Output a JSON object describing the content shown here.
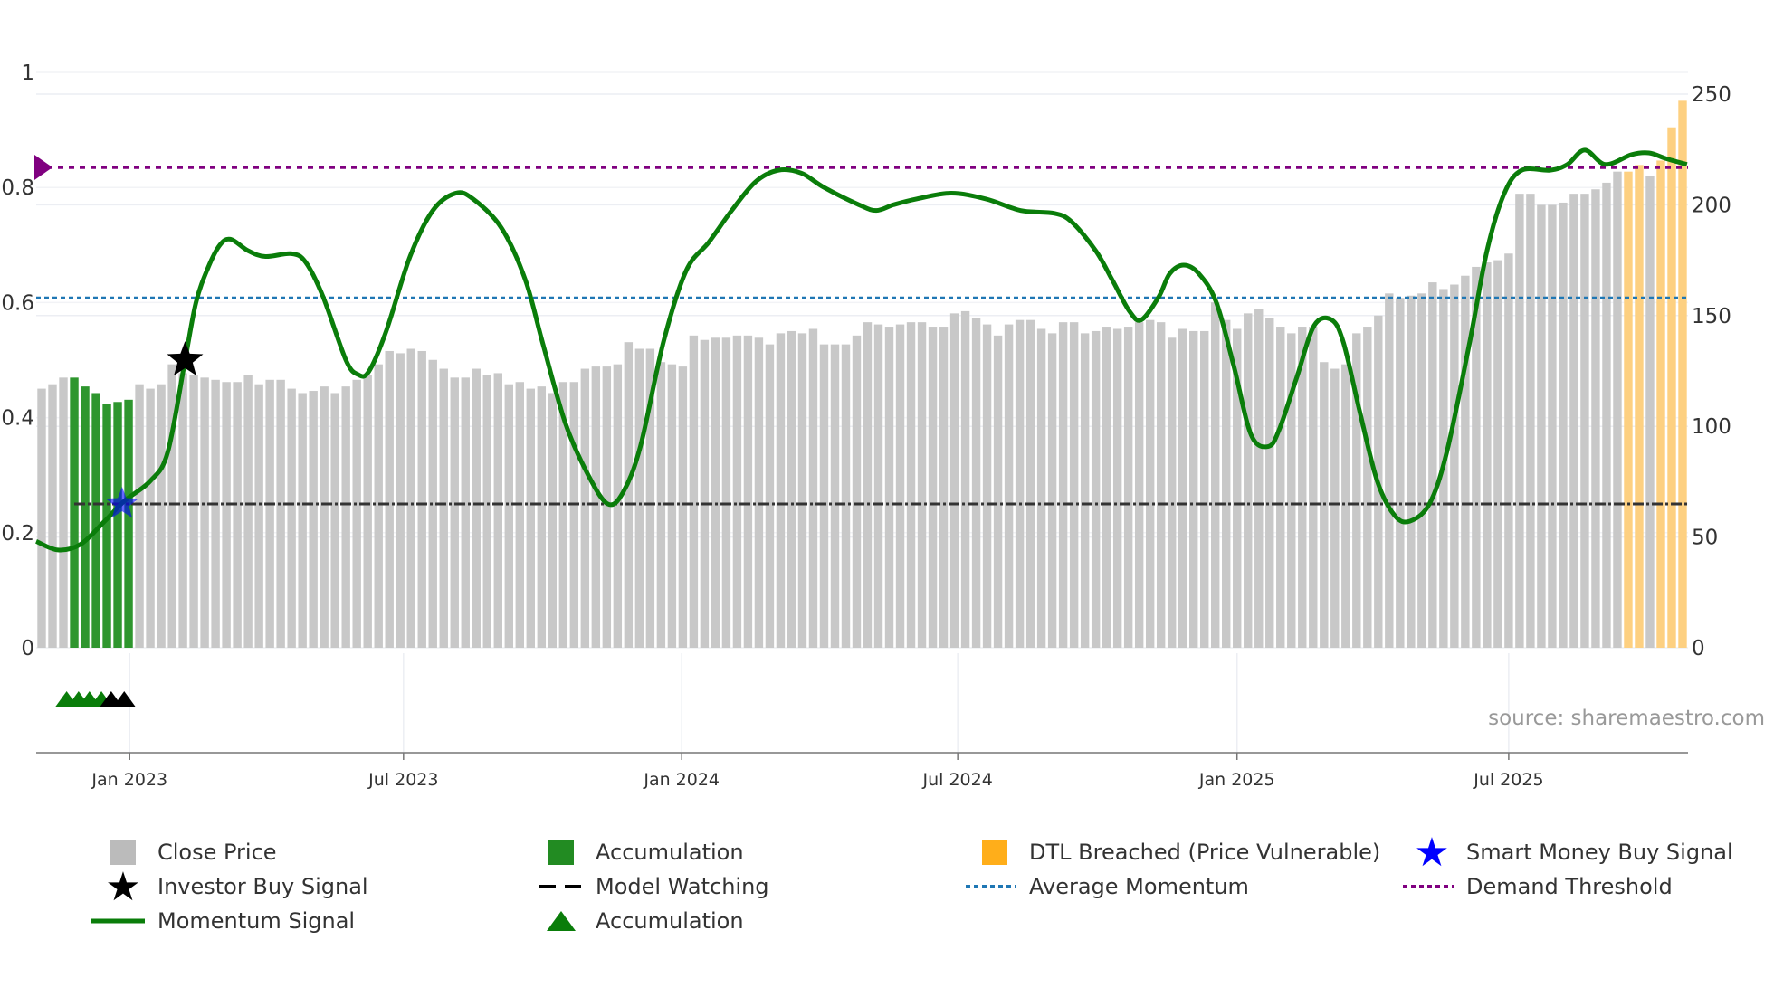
{
  "chart_data": {
    "type": "bar",
    "title": "",
    "left_axis": {
      "ticks": [
        0,
        0.2,
        0.4,
        0.6,
        0.8,
        1
      ],
      "tick_labels": [
        "0",
        "0.2",
        "0.4",
        "0.6",
        "0.8",
        "1"
      ],
      "range": [
        0,
        1
      ]
    },
    "right_axis": {
      "ticks": [
        0,
        50,
        100,
        150,
        200,
        250
      ],
      "tick_labels": [
        "0",
        "50",
        "100",
        "150",
        "200",
        "250"
      ],
      "range": [
        0,
        250
      ]
    },
    "x_ticks": [
      {
        "label": "Jan 2023",
        "week": 8.1
      },
      {
        "label": "Jul 2023",
        "week": 33.3
      },
      {
        "label": "Jan 2024",
        "week": 58.9
      },
      {
        "label": "Jul 2024",
        "week": 84.3
      },
      {
        "label": "Jan 2025",
        "week": 110
      },
      {
        "label": "Jul 2025",
        "week": 135
      }
    ],
    "close_price": [
      117,
      119,
      122,
      122,
      118,
      115,
      110,
      111,
      112,
      119,
      117,
      119,
      128,
      124,
      123,
      122,
      121,
      120,
      120,
      123,
      119,
      121,
      121,
      117,
      115,
      116,
      118,
      115,
      118,
      121,
      123,
      128,
      134,
      133,
      135,
      134,
      130,
      126,
      122,
      122,
      126,
      123,
      124,
      119,
      120,
      117,
      118,
      115,
      120,
      120,
      126,
      127,
      127,
      128,
      138,
      135,
      135,
      129,
      128,
      127,
      141,
      139,
      140,
      140,
      141,
      141,
      140,
      137,
      142,
      143,
      142,
      144,
      137,
      137,
      137,
      141,
      147,
      146,
      145,
      146,
      147,
      147,
      145,
      145,
      151,
      152,
      149,
      146,
      141,
      146,
      148,
      148,
      144,
      142,
      147,
      147,
      142,
      143,
      145,
      144,
      145,
      147,
      148,
      147,
      140,
      144,
      143,
      143,
      156,
      148,
      144,
      151,
      153,
      149,
      145,
      142,
      145,
      145,
      129,
      126,
      128,
      142,
      145,
      150,
      160,
      158,
      159,
      160,
      165,
      162,
      164,
      168,
      172,
      174,
      175,
      178,
      205,
      205,
      200,
      200,
      201,
      205,
      205,
      207,
      210,
      215,
      215,
      218,
      213,
      220,
      235,
      247
    ],
    "accumulation_weeks": [
      3,
      4,
      5,
      6,
      7,
      8
    ],
    "dtl_breached_weeks": [
      146,
      147,
      149,
      150,
      151
    ],
    "momentum": [
      [
        0,
        0.185
      ],
      [
        2,
        0.17
      ],
      [
        4.1,
        0.18
      ],
      [
        6.3,
        0.22
      ],
      [
        8.1,
        0.255
      ],
      [
        10.5,
        0.29
      ],
      [
        12.1,
        0.34
      ],
      [
        13.7,
        0.5
      ],
      [
        14.7,
        0.6
      ],
      [
        15.8,
        0.66
      ],
      [
        16.9,
        0.7
      ],
      [
        17.9,
        0.71
      ],
      [
        19.5,
        0.69
      ],
      [
        21.1,
        0.68
      ],
      [
        23.5,
        0.685
      ],
      [
        24.8,
        0.67
      ],
      [
        26.4,
        0.61
      ],
      [
        28.5,
        0.5
      ],
      [
        29.6,
        0.475
      ],
      [
        30.6,
        0.48
      ],
      [
        32.2,
        0.55
      ],
      [
        34.4,
        0.68
      ],
      [
        36.5,
        0.76
      ],
      [
        38.6,
        0.79
      ],
      [
        40.2,
        0.78
      ],
      [
        42.8,
        0.73
      ],
      [
        45,
        0.64
      ],
      [
        46.6,
        0.53
      ],
      [
        48.7,
        0.39
      ],
      [
        50.8,
        0.3
      ],
      [
        52.6,
        0.25
      ],
      [
        54,
        0.27
      ],
      [
        55.6,
        0.35
      ],
      [
        57.7,
        0.53
      ],
      [
        59.8,
        0.655
      ],
      [
        61.9,
        0.705
      ],
      [
        64,
        0.76
      ],
      [
        66.2,
        0.81
      ],
      [
        68.3,
        0.83
      ],
      [
        70.4,
        0.825
      ],
      [
        72.5,
        0.8
      ],
      [
        75.7,
        0.77
      ],
      [
        77.3,
        0.76
      ],
      [
        78.9,
        0.77
      ],
      [
        81,
        0.78
      ],
      [
        84.2,
        0.79
      ],
      [
        87.4,
        0.78
      ],
      [
        90.6,
        0.76
      ],
      [
        93.7,
        0.755
      ],
      [
        95.3,
        0.74
      ],
      [
        97.5,
        0.69
      ],
      [
        99,
        0.64
      ],
      [
        100.6,
        0.585
      ],
      [
        101.7,
        0.57
      ],
      [
        103.3,
        0.61
      ],
      [
        104.3,
        0.65
      ],
      [
        105.6,
        0.665
      ],
      [
        107,
        0.65
      ],
      [
        108.6,
        0.6
      ],
      [
        110.2,
        0.49
      ],
      [
        111.8,
        0.37
      ],
      [
        113.4,
        0.35
      ],
      [
        114.4,
        0.38
      ],
      [
        116,
        0.47
      ],
      [
        117.6,
        0.56
      ],
      [
        119.2,
        0.57
      ],
      [
        120.3,
        0.53
      ],
      [
        121.8,
        0.41
      ],
      [
        123.4,
        0.29
      ],
      [
        125,
        0.23
      ],
      [
        126.4,
        0.22
      ],
      [
        128.2,
        0.25
      ],
      [
        129.8,
        0.34
      ],
      [
        131.9,
        0.53
      ],
      [
        133.5,
        0.69
      ],
      [
        135.1,
        0.79
      ],
      [
        136.7,
        0.83
      ],
      [
        139.3,
        0.83
      ],
      [
        140.9,
        0.84
      ],
      [
        142.5,
        0.865
      ],
      [
        144.4,
        0.84
      ],
      [
        146.8,
        0.857
      ],
      [
        148.4,
        0.86
      ],
      [
        150,
        0.85
      ],
      [
        151.9,
        0.84
      ]
    ],
    "average_momentum": 0.608,
    "demand_threshold": 0.835,
    "model_watching": 0.25,
    "investor_buy_signals": [
      {
        "week": 13.7,
        "value": 0.5
      }
    ],
    "smart_money_buy_signals": [
      {
        "week": 7.9,
        "value": 0.25
      }
    ],
    "accumulation_markers": [
      2.8,
      3.9,
      4.9,
      6.0
    ],
    "model_watching_markers": [
      6.9,
      8.1
    ],
    "source": "source: sharemaestro.com",
    "colors": {
      "price": "#c8c8c8",
      "accumulation": "#2e962e",
      "dtl": "#fdd081",
      "momentum": "#0a7d0a",
      "average": "#1f77b4",
      "threshold": "#800080",
      "watching": "#333333",
      "smart": "#0000ff"
    },
    "legend": [
      {
        "label": "Close Price"
      },
      {
        "label": "Accumulation"
      },
      {
        "label": "DTL Breached (Price Vulnerable)"
      },
      {
        "label": "Smart Money Buy Signal"
      },
      {
        "label": "Investor Buy Signal"
      },
      {
        "label": "Model Watching"
      },
      {
        "label": "Average Momentum"
      },
      {
        "label": "Demand Threshold"
      },
      {
        "label": "Momentum Signal"
      },
      {
        "label": "Accumulation"
      }
    ],
    "legend_placement": "bottom"
  }
}
